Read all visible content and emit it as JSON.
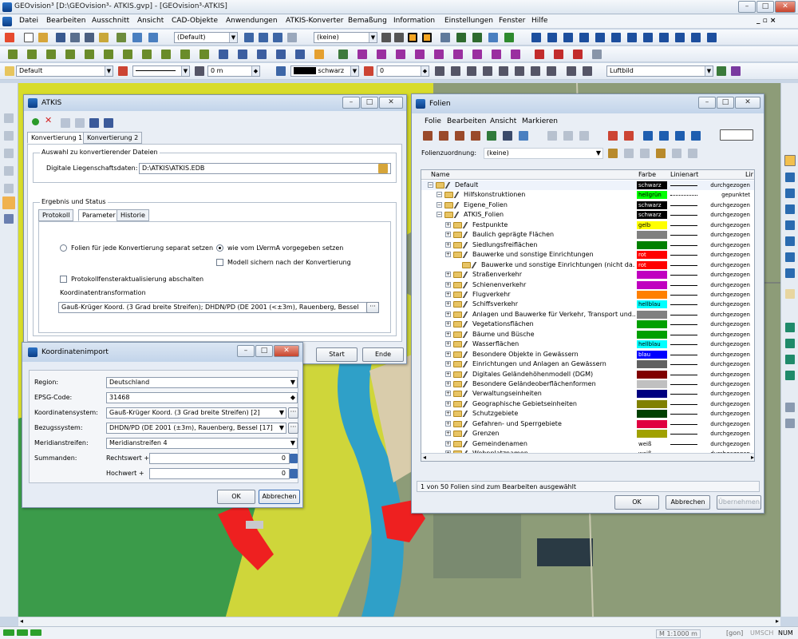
{
  "titlebar": {
    "title": "GEOvision³  [D:\\GEOvision³- ATKIS.gvp] - [GEOvision³-ATKIS]"
  },
  "menu": [
    "Datei",
    "Bearbeiten",
    "Ausschnitt",
    "Ansicht",
    "CAD-Objekte",
    "Anwendungen",
    "ATKIS-Konverter",
    "Bemaßung",
    "Information",
    "Einstellungen",
    "Fenster",
    "Hilfe"
  ],
  "toolbar1": {
    "combo1": "(Default)",
    "combo2": "(keine)"
  },
  "toolbar3": {
    "layer": "Default",
    "width": "0 m",
    "color": "schwarz",
    "num": "0",
    "view": "Luftbild"
  },
  "atkis": {
    "title": "ATKIS",
    "tabs": [
      "Konvertierung 1",
      "Konvertierung 2"
    ],
    "group1": "Auswahl zu konvertierender Dateien",
    "db_label": "Digitale Liegenschaftsdaten:",
    "db_value": "D:\\ATKIS\\ATKIS.EDB",
    "group2": "Ergebnis und Status",
    "subtabs": [
      "Protokoll",
      "Parameter",
      "Historie"
    ],
    "radio1": "Folien für jede Konvertierung separat setzen",
    "radio2": "wie vom LVermA vorgegeben setzen",
    "chk1": "Modell sichern nach der Konvertierung",
    "chk2": "Protokollfensteraktualisierung abschalten",
    "transform_label": "Koordinatentransformation",
    "transform_value": "Gauß-Krüger Koord. (3 Grad breite Streifen); DHDN/PD (DE 2001 (<±3m), Rauenberg, Bessel",
    "start": "Start",
    "end": "Ende"
  },
  "koord": {
    "title": "Koordinatenimport",
    "region_label": "Region:",
    "region": "Deutschland",
    "epsg_label": "EPSG-Code:",
    "epsg": "31468",
    "system_label": "Koordinatensystem:",
    "system": "Gauß-Krüger Koord. (3 Grad breite Streifen) [2]",
    "bezug_label": "Bezugssystem:",
    "bezug": "DHDN/PD (DE 2001 (±3m), Rauenberg, Bessel [17]",
    "meridian_label": "Meridianstreifen:",
    "meridian": "Meridianstreifen 4",
    "summanden_label": "Summanden:",
    "rechts_label": "Rechtswert +",
    "rechts": "0",
    "hoch_label": "Hochwert +",
    "hoch": "0",
    "ok": "OK",
    "cancel": "Abbrechen"
  },
  "folien": {
    "title": "Folien",
    "menu": [
      "Folie",
      "Bearbeiten",
      "Ansicht",
      "Markieren"
    ],
    "zuordnung_label": "Folienzuordnung:",
    "zuordnung_value": "(keine)",
    "col_name": "Name",
    "col_farbe": "Farbe",
    "col_linie": "Linienart",
    "col_extra": "Lir",
    "rows": [
      {
        "name": "Default",
        "farbe": "schwarz",
        "swatch": "#000000",
        "fg": "#ffffff",
        "linie": "durchgezogen",
        "lvl": 0
      },
      {
        "name": "Hilfskonstruktionen",
        "farbe": "hellgrün",
        "swatch": "#00ff00",
        "fg": "#000000",
        "linie": "gepunktet",
        "lvl": 1
      },
      {
        "name": "Eigene_Folien",
        "farbe": "schwarz",
        "swatch": "#000000",
        "fg": "#ffffff",
        "linie": "durchgezogen",
        "lvl": 1
      },
      {
        "name": "ATKIS_Folien",
        "farbe": "schwarz",
        "swatch": "#000000",
        "fg": "#ffffff",
        "linie": "durchgezogen",
        "lvl": 1
      },
      {
        "name": "Festpunkte",
        "farbe": "gelb",
        "swatch": "#ffff00",
        "fg": "#000000",
        "linie": "durchgezogen",
        "lvl": 2
      },
      {
        "name": "Baulich geprägte Flächen",
        "farbe": "",
        "swatch": "#808080",
        "fg": "#000000",
        "linie": "durchgezogen",
        "lvl": 2
      },
      {
        "name": "Siedlungsfreiflächen",
        "farbe": "",
        "swatch": "#008000",
        "fg": "#000000",
        "linie": "durchgezogen",
        "lvl": 2
      },
      {
        "name": "Bauwerke und sonstige Einrichtungen",
        "farbe": "rot",
        "swatch": "#ff0000",
        "fg": "#ffffff",
        "linie": "durchgezogen",
        "lvl": 2
      },
      {
        "name": "Bauwerke und sonstige Einrichtungen (nicht da...",
        "farbe": "rot",
        "swatch": "#ff0000",
        "fg": "#ffffff",
        "linie": "durchgezogen",
        "lvl": 3
      },
      {
        "name": "Straßenverkehr",
        "farbe": "",
        "swatch": "#c000c0",
        "fg": "#000000",
        "linie": "durchgezogen",
        "lvl": 2
      },
      {
        "name": "Schienenverkehr",
        "farbe": "",
        "swatch": "#c000c0",
        "fg": "#000000",
        "linie": "durchgezogen",
        "lvl": 2
      },
      {
        "name": "Flugverkehr",
        "farbe": "",
        "swatch": "#ff8000",
        "fg": "#000000",
        "linie": "durchgezogen",
        "lvl": 2
      },
      {
        "name": "Schiffsverkehr",
        "farbe": "hellblau",
        "swatch": "#00ffff",
        "fg": "#000000",
        "linie": "durchgezogen",
        "lvl": 2
      },
      {
        "name": "Anlagen und Bauwerke für Verkehr, Transport und...",
        "farbe": "",
        "swatch": "#808080",
        "fg": "#000000",
        "linie": "durchgezogen",
        "lvl": 2
      },
      {
        "name": "Vegetationsflächen",
        "farbe": "",
        "swatch": "#00a000",
        "fg": "#000000",
        "linie": "durchgezogen",
        "lvl": 2
      },
      {
        "name": "Bäume und Büsche",
        "farbe": "",
        "swatch": "#00a000",
        "fg": "#000000",
        "linie": "durchgezogen",
        "lvl": 2
      },
      {
        "name": "Wasserflächen",
        "farbe": "hellblau",
        "swatch": "#00ffff",
        "fg": "#000000",
        "linie": "durchgezogen",
        "lvl": 2
      },
      {
        "name": "Besondere Objekte in Gewässern",
        "farbe": "blau",
        "swatch": "#0000ff",
        "fg": "#ffffff",
        "linie": "durchgezogen",
        "lvl": 2
      },
      {
        "name": "Einrichtungen und Anlagen an Gewässern",
        "farbe": "",
        "swatch": "#606060",
        "fg": "#000000",
        "linie": "durchgezogen",
        "lvl": 2
      },
      {
        "name": "Digitales Geländehöhenmodell (DGM)",
        "farbe": "",
        "swatch": "#800000",
        "fg": "#000000",
        "linie": "durchgezogen",
        "lvl": 2
      },
      {
        "name": "Besondere Geländeoberflächenformen",
        "farbe": "",
        "swatch": "#c0c0c0",
        "fg": "#000000",
        "linie": "durchgezogen",
        "lvl": 2
      },
      {
        "name": "Verwaltungseinheiten",
        "farbe": "",
        "swatch": "#000080",
        "fg": "#000000",
        "linie": "durchgezogen",
        "lvl": 2
      },
      {
        "name": "Geographische Gebietseinheiten",
        "farbe": "",
        "swatch": "#808000",
        "fg": "#000000",
        "linie": "durchgezogen",
        "lvl": 2
      },
      {
        "name": "Schutzgebiete",
        "farbe": "",
        "swatch": "#004000",
        "fg": "#000000",
        "linie": "durchgezogen",
        "lvl": 2
      },
      {
        "name": "Gefahren- und Sperrgebiete",
        "farbe": "",
        "swatch": "#e00040",
        "fg": "#000000",
        "linie": "durchgezogen",
        "lvl": 2
      },
      {
        "name": "Grenzen",
        "farbe": "",
        "swatch": "#a0a000",
        "fg": "#000000",
        "linie": "durchgezogen",
        "lvl": 2
      },
      {
        "name": "Gemeindenamen",
        "farbe": "weiß",
        "swatch": "#ffffff",
        "fg": "#000000",
        "linie": "durchgezogen",
        "lvl": 2
      },
      {
        "name": "Wohnplatznamen",
        "farbe": "weiß",
        "swatch": "#ffffff",
        "fg": "#000000",
        "linie": "durchgezogen",
        "lvl": 2
      }
    ],
    "status": "1 von 50 Folien sind zum Bearbeiten ausgewählt",
    "ok": "OK",
    "cancel": "Abbrechen",
    "accept": "Übernehmen"
  },
  "statusbar": {
    "scale": "M 1:1000  m",
    "unit": "[gon]",
    "caps": "UMSCH",
    "num": "NUM"
  }
}
